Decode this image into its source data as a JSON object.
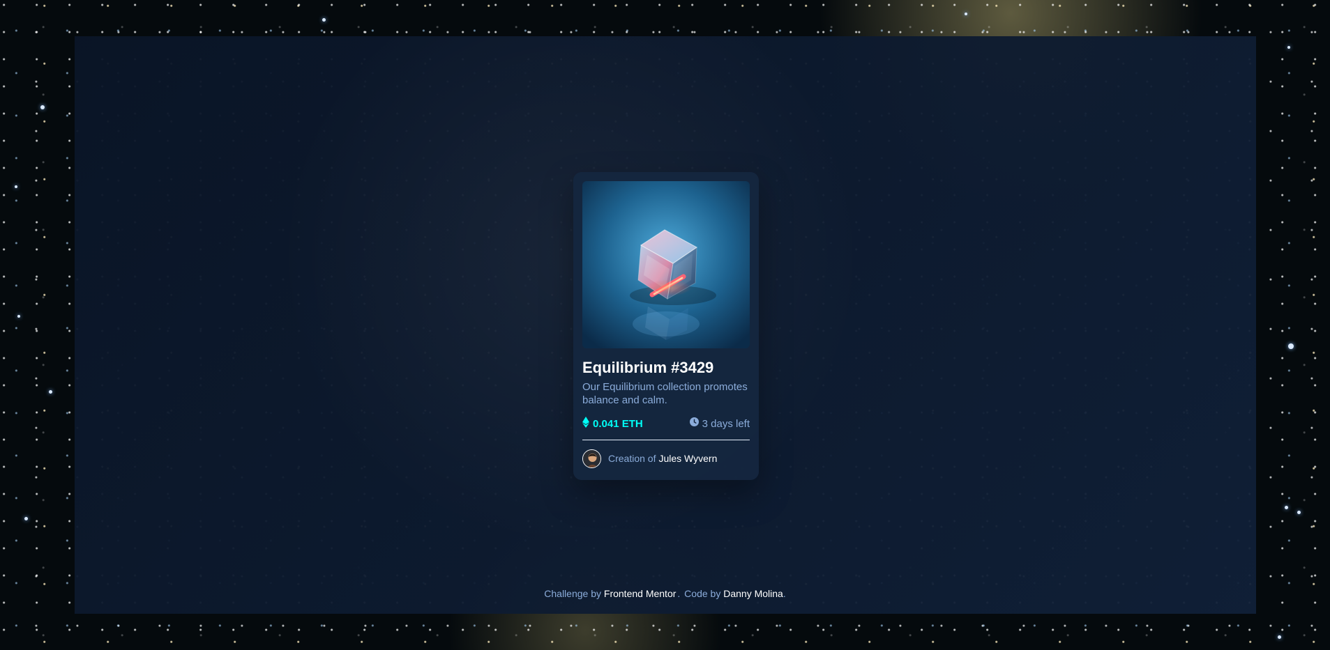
{
  "card": {
    "title": "Equilibrium #3429",
    "description": "Our Equilibrium collection promotes balance and calm.",
    "price": "0.041 ETH",
    "time_left": "3 days left",
    "creator_prefix": "Creation of",
    "creator_name": "Jules Wyvern"
  },
  "footer": {
    "challenge_prefix": "Challenge by",
    "challenge_link": "Frontend Mentor",
    "separator": ".",
    "code_prefix": "Code by",
    "code_link": "Danny Molina",
    "end_punctuation": "."
  },
  "colors": {
    "accent": "#00fff7",
    "muted_text": "#8bacda",
    "card_bg": "#15263f",
    "overlay_bg": "#0d1a2d"
  },
  "icons": {
    "ethereum": "ethereum-icon",
    "clock": "clock-icon",
    "avatar": "avatar"
  }
}
